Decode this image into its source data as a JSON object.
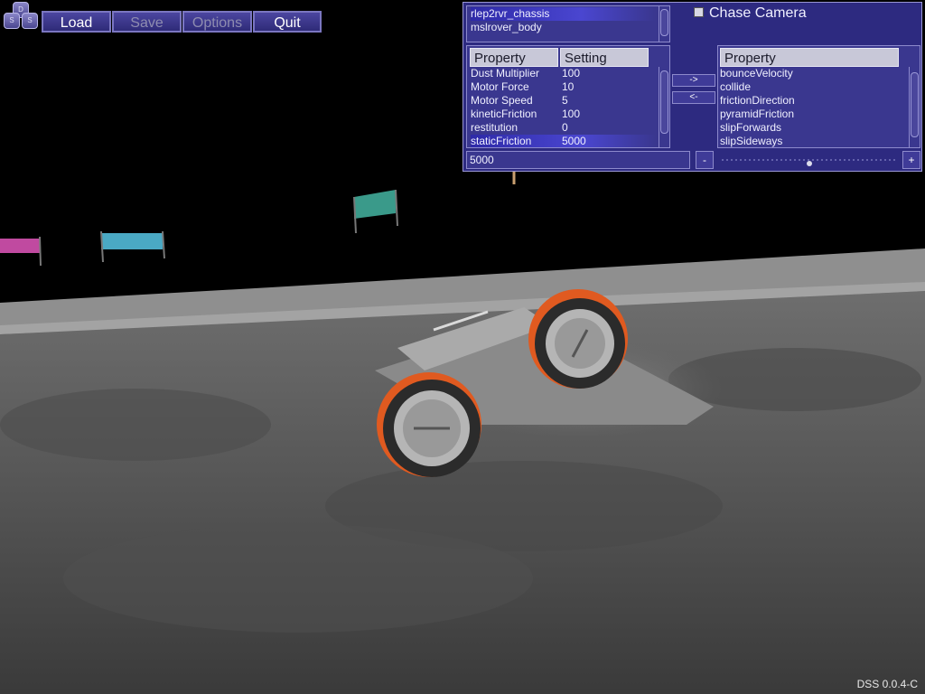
{
  "app": {
    "logo_letters": [
      "D",
      "S",
      "S"
    ],
    "version": "DSS 0.0.4-C"
  },
  "menu": {
    "load": "Load",
    "save": "Save",
    "options": "Options",
    "quit": "Quit"
  },
  "panel": {
    "bodies": [
      "rlep2rvr_chassis",
      "mslrover_body"
    ],
    "selected_body_index": 0,
    "chase_camera_label": "Chase Camera",
    "chase_camera_checked": false,
    "left_table": {
      "headers": [
        "Property",
        "Setting"
      ],
      "rows": [
        [
          "Dust Multiplier",
          "100"
        ],
        [
          "Motor Force",
          "10"
        ],
        [
          "Motor Speed",
          "5"
        ],
        [
          "kineticFriction",
          "100"
        ],
        [
          "restitution",
          "0"
        ],
        [
          "staticFriction",
          "5000"
        ]
      ],
      "selected_row_index": 5
    },
    "add_arrow": "->",
    "remove_arrow": "<-",
    "right_table": {
      "header": "Property",
      "rows": [
        "bounceVelocity",
        "collide",
        "frictionDirection",
        "pyramidFriction",
        "slipForwards",
        "slipSideways"
      ]
    },
    "value_field": "5000",
    "minus_label": "-",
    "plus_label": "+",
    "slider_fraction": 0.5
  },
  "colors": {
    "panel_bg": "#2d2a80",
    "panel_border": "#9996d4",
    "selection": "#4a46d0",
    "regolith": "#7c7c7c"
  }
}
